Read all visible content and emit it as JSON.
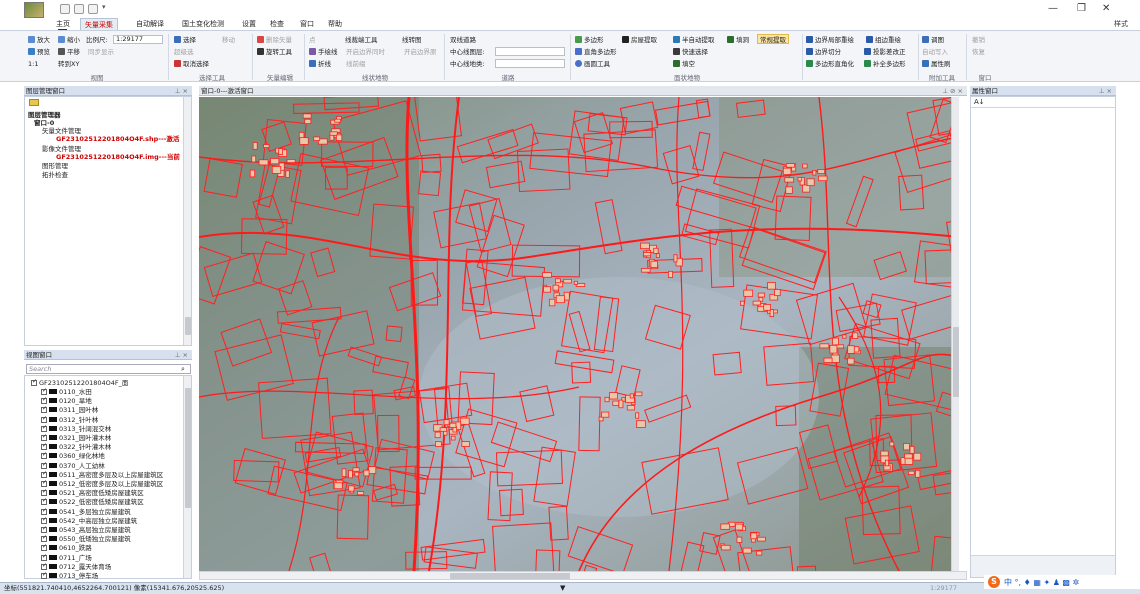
{
  "window": {
    "quick_caret": "▾",
    "min": "—",
    "max": "❐",
    "close": "✕"
  },
  "menu": {
    "tabs": [
      "主页",
      "矢量采集",
      "自动解译",
      "国土变化检测",
      "设置",
      "检查",
      "窗口",
      "帮助"
    ],
    "active_index": 1,
    "style_label": "样式",
    "keytip": "H"
  },
  "ribbon": {
    "view": {
      "zoom_in": "放大",
      "zoom_out": "缩小",
      "scale_label": "比例尺:",
      "scale_value": "1:29177",
      "preview": "预览",
      "pan": "平移",
      "sync": "同步显示",
      "one_to_one": "1:1",
      "goto": "转到XY",
      "group": "视图"
    },
    "select": {
      "select": "选择",
      "move": "移动",
      "multi": "超级选",
      "cancel": "取消选择",
      "group": "选择工具"
    },
    "vector": {
      "delete": "删除矢量",
      "rotate": "旋转工具",
      "group": "矢量编辑"
    },
    "line": {
      "point": "点",
      "handdraw": "手绘线",
      "polyline": "折线",
      "line_edge": "线裁端工具",
      "open_edge": "开启边界同时",
      "open_proto": "开启边界原",
      "line_fig": "线转图",
      "line_prefix": "线前缀",
      "group": "线状地物"
    },
    "road": {
      "double": "双线道路",
      "center_layer": "中心线图层:",
      "center_ground": "中心线地类:",
      "group": "道路"
    },
    "polygon": {
      "poly": "多边形",
      "rect_poly": "直角多边形",
      "circle": "画圆工具",
      "house": "房屋提取",
      "semi": "半自动提取",
      "quick": "快速选择",
      "fill": "填空",
      "fill_hole": "填洞",
      "normal": "常规提取",
      "group": "面状地物"
    },
    "boundary": {
      "overlap": "边界局部重绘",
      "local": "组边重绘",
      "split": "边界切分",
      "projection": "投影差改正",
      "poly_corner": "多边形直角化",
      "poly_add": "补全多边形",
      "group": "附加工具"
    },
    "extra": {
      "table": "调图",
      "auto_write": "自动写入",
      "attr": "属性刷",
      "undo": "撤销",
      "redo": "恢复",
      "group": "窗口"
    }
  },
  "layer_panel": {
    "title": "图层管理窗口",
    "items": [
      "图层管理器",
      "窗口-0",
      "矢量文件管理",
      "GF23102512201804O4F.shp---激活",
      "影像文件管理",
      "GF23102512201804O4F.img---当前",
      "图形管理",
      "拓扑检查"
    ]
  },
  "legend_panel": {
    "title": "视图窗口",
    "search_placeholder": "Search",
    "root": "GF23102512201804O4F_面",
    "items": [
      "0110_水田",
      "0120_旱地",
      "0311_园叶林",
      "0312_针叶林",
      "0313_针阔混交林",
      "0321_园叶灌木林",
      "0322_针叶灌木林",
      "0360_绿化林地",
      "0370_人工幼林",
      "0511_高密度多层及以上房屋建筑区",
      "0512_低密度多层及以上房屋建筑区",
      "0521_高密度低矮房屋建筑区",
      "0522_低密度低矮房屋建筑区",
      "0541_多层独立房屋建筑",
      "0542_中高层独立房屋建筑",
      "0543_高层独立房屋建筑",
      "0550_低矮独立房屋建筑",
      "0610_跌路",
      "0711_广场",
      "0712_露天体育场",
      "0713_停车场"
    ]
  },
  "map": {
    "tab_title": "窗口-0---激活窗口",
    "tools": "⊥ ⊘ ×"
  },
  "attr_panel": {
    "title": "属性窗口",
    "sort": "A↓"
  },
  "status": {
    "coords": "坐标(551821.740410,4652264.700121) 像素(15341.676,20525.625)",
    "scale": "1:29177"
  },
  "ime": {
    "logo": "S",
    "icons": "中 °, ♦ ▦ ✦ ♟ ▩ ✲"
  },
  "colors": {
    "accent": "#c00000",
    "line": "#ff2020",
    "ribbon_bg": "#f3f5f8",
    "panel_hdr": "#d6e0ee"
  }
}
